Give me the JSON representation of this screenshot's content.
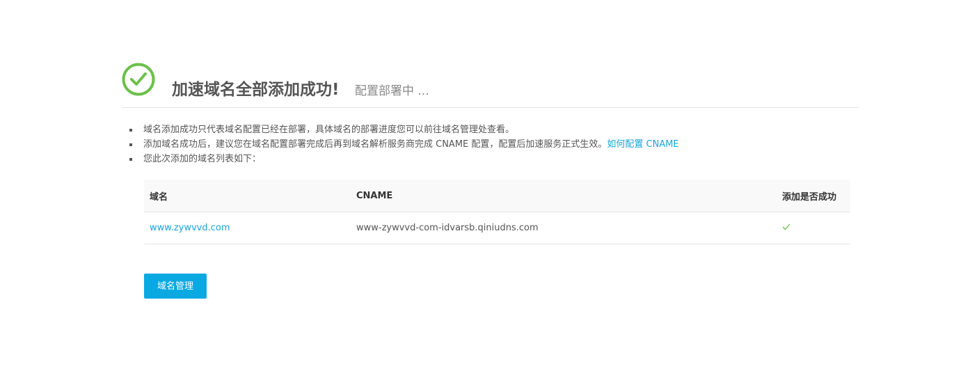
{
  "header": {
    "icon": "check-circle-icon",
    "title": "加速域名全部添加成功!",
    "status": "配置部署中 ..."
  },
  "notes": [
    {
      "text": "域名添加成功只代表域名配置已经在部署，具体域名的部署进度您可以前往域名管理处查看。",
      "link": ""
    },
    {
      "text": "添加域名成功后，建议您在域名配置部署完成后再到域名解析服务商完成 CNAME 配置，配置后加速服务正式生效。",
      "link": "如何配置 CNAME"
    },
    {
      "text": "您此次添加的域名列表如下：",
      "link": ""
    }
  ],
  "table": {
    "headers": [
      "域名",
      "CNAME",
      "添加是否成功"
    ],
    "rows": [
      {
        "domain": "www.zywvvd.com",
        "cname": "www-zywvvd-com-idvarsb.qiniudns.com",
        "status_icon": "check-icon"
      }
    ]
  },
  "actions": {
    "manage_button": "域名管理"
  },
  "colors": {
    "success": "#6cc04a",
    "accent": "#0aa9e2",
    "link": "#19a4d6"
  }
}
